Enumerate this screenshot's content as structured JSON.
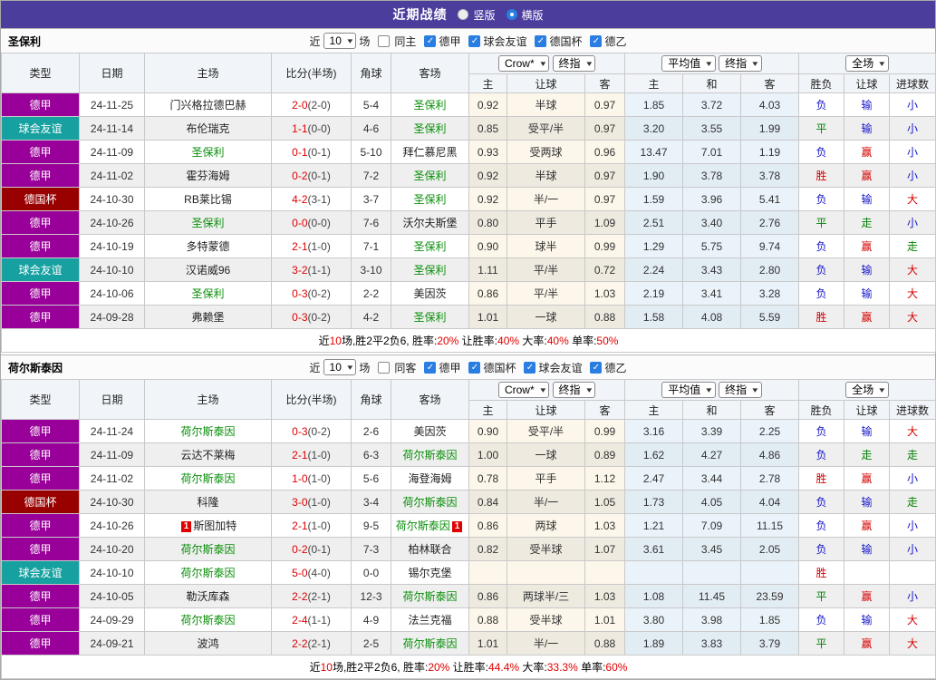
{
  "colors": {
    "accent": "#4b3d9c",
    "league_purple": "#990099",
    "league_teal": "#16a0a0",
    "league_darkred": "#990000",
    "team_green": "#0a8f0a",
    "score_red": "#e00000",
    "win_red": "#d40000",
    "draw_green": "#008000",
    "loss_blue": "#1515c8",
    "checkbox_blue": "#2a7de1"
  },
  "title": {
    "text": "近期战绩",
    "radio_vertical": "竖版",
    "radio_horizontal": "横版",
    "selected": "横版"
  },
  "table_header": {
    "cols": [
      "类型",
      "日期",
      "主场",
      "比分(半场)",
      "角球",
      "客场"
    ],
    "crow_select": "Crow*",
    "final_select": "终指",
    "avg_select": "平均值",
    "final_select2": "终指",
    "full_select": "全场",
    "sub_cols": [
      "主",
      "让球",
      "客",
      "主",
      "和",
      "客",
      "胜负",
      "让球",
      "进球数"
    ]
  },
  "sections": [
    {
      "team": "圣保利",
      "filter": {
        "near": "近",
        "count": "10",
        "games": "场",
        "same": "同主",
        "leagues": [
          "德甲",
          "球会友谊",
          "德国杯",
          "德乙"
        ]
      },
      "rows": [
        {
          "lg": "德甲",
          "lgc": "purple",
          "date": "24-11-25",
          "home": "门兴格拉德巴赫",
          "hh": false,
          "hcard": "",
          "score": "2-0",
          "half": "(2-0)",
          "corner": "5-4",
          "away": "圣保利",
          "ah": true,
          "acard": "",
          "odds": [
            "0.92",
            "半球",
            "0.97"
          ],
          "avg": [
            "1.85",
            "3.72",
            "4.03"
          ],
          "res": [
            [
              "负",
              "b"
            ],
            [
              "输",
              "b"
            ],
            [
              "小",
              "b"
            ]
          ]
        },
        {
          "lg": "球会友谊",
          "lgc": "teal",
          "date": "24-11-14",
          "home": "布伦瑞克",
          "hh": false,
          "hcard": "",
          "score": "1-1",
          "half": "(0-0)",
          "corner": "4-6",
          "away": "圣保利",
          "ah": true,
          "acard": "",
          "odds": [
            "0.85",
            "受平/半",
            "0.97"
          ],
          "avg": [
            "3.20",
            "3.55",
            "1.99"
          ],
          "res": [
            [
              "平",
              "g"
            ],
            [
              "输",
              "b"
            ],
            [
              "小",
              "b"
            ]
          ]
        },
        {
          "lg": "德甲",
          "lgc": "purple",
          "date": "24-11-09",
          "home": "圣保利",
          "hh": true,
          "hcard": "",
          "score": "0-1",
          "half": "(0-1)",
          "corner": "5-10",
          "away": "拜仁慕尼黑",
          "ah": false,
          "acard": "",
          "odds": [
            "0.93",
            "受两球",
            "0.96"
          ],
          "avg": [
            "13.47",
            "7.01",
            "1.19"
          ],
          "res": [
            [
              "负",
              "b"
            ],
            [
              "赢",
              "r"
            ],
            [
              "小",
              "b"
            ]
          ]
        },
        {
          "lg": "德甲",
          "lgc": "purple",
          "date": "24-11-02",
          "home": "霍芬海姆",
          "hh": false,
          "hcard": "",
          "score": "0-2",
          "half": "(0-1)",
          "corner": "7-2",
          "away": "圣保利",
          "ah": true,
          "acard": "",
          "odds": [
            "0.92",
            "半球",
            "0.97"
          ],
          "avg": [
            "1.90",
            "3.78",
            "3.78"
          ],
          "res": [
            [
              "胜",
              "r"
            ],
            [
              "赢",
              "r"
            ],
            [
              "小",
              "b"
            ]
          ]
        },
        {
          "lg": "德国杯",
          "lgc": "darkred",
          "date": "24-10-30",
          "home": "RB莱比锡",
          "hh": false,
          "hcard": "",
          "score": "4-2",
          "half": "(3-1)",
          "corner": "3-7",
          "away": "圣保利",
          "ah": true,
          "acard": "",
          "odds": [
            "0.92",
            "半/一",
            "0.97"
          ],
          "avg": [
            "1.59",
            "3.96",
            "5.41"
          ],
          "res": [
            [
              "负",
              "b"
            ],
            [
              "输",
              "b"
            ],
            [
              "大",
              "r"
            ]
          ]
        },
        {
          "lg": "德甲",
          "lgc": "purple",
          "date": "24-10-26",
          "home": "圣保利",
          "hh": true,
          "hcard": "",
          "score": "0-0",
          "half": "(0-0)",
          "corner": "7-6",
          "away": "沃尔夫斯堡",
          "ah": false,
          "acard": "",
          "odds": [
            "0.80",
            "平手",
            "1.09"
          ],
          "avg": [
            "2.51",
            "3.40",
            "2.76"
          ],
          "res": [
            [
              "平",
              "g"
            ],
            [
              "走",
              "g"
            ],
            [
              "小",
              "b"
            ]
          ]
        },
        {
          "lg": "德甲",
          "lgc": "purple",
          "date": "24-10-19",
          "home": "多特蒙德",
          "hh": false,
          "hcard": "",
          "score": "2-1",
          "half": "(1-0)",
          "corner": "7-1",
          "away": "圣保利",
          "ah": true,
          "acard": "",
          "odds": [
            "0.90",
            "球半",
            "0.99"
          ],
          "avg": [
            "1.29",
            "5.75",
            "9.74"
          ],
          "res": [
            [
              "负",
              "b"
            ],
            [
              "赢",
              "r"
            ],
            [
              "走",
              "g"
            ]
          ]
        },
        {
          "lg": "球会友谊",
          "lgc": "teal",
          "date": "24-10-10",
          "home": "汉诺威96",
          "hh": false,
          "hcard": "",
          "score": "3-2",
          "half": "(1-1)",
          "corner": "3-10",
          "away": "圣保利",
          "ah": true,
          "acard": "",
          "odds": [
            "1.11",
            "平/半",
            "0.72"
          ],
          "avg": [
            "2.24",
            "3.43",
            "2.80"
          ],
          "res": [
            [
              "负",
              "b"
            ],
            [
              "输",
              "b"
            ],
            [
              "大",
              "r"
            ]
          ]
        },
        {
          "lg": "德甲",
          "lgc": "purple",
          "date": "24-10-06",
          "home": "圣保利",
          "hh": true,
          "hcard": "",
          "score": "0-3",
          "half": "(0-2)",
          "corner": "2-2",
          "away": "美因茨",
          "ah": false,
          "acard": "",
          "odds": [
            "0.86",
            "平/半",
            "1.03"
          ],
          "avg": [
            "2.19",
            "3.41",
            "3.28"
          ],
          "res": [
            [
              "负",
              "b"
            ],
            [
              "输",
              "b"
            ],
            [
              "大",
              "r"
            ]
          ]
        },
        {
          "lg": "德甲",
          "lgc": "purple",
          "date": "24-09-28",
          "home": "弗赖堡",
          "hh": false,
          "hcard": "",
          "score": "0-3",
          "half": "(0-2)",
          "corner": "4-2",
          "away": "圣保利",
          "ah": true,
          "acard": "",
          "odds": [
            "1.01",
            "一球",
            "0.88"
          ],
          "avg": [
            "1.58",
            "4.08",
            "5.59"
          ],
          "res": [
            [
              "胜",
              "r"
            ],
            [
              "赢",
              "r"
            ],
            [
              "大",
              "r"
            ]
          ]
        }
      ],
      "summary": {
        "p1": "近",
        "n1": "10",
        "p2": "场,胜2平2负6, 胜率:",
        "v1": "20%",
        "p3": " 让胜率:",
        "v2": "40%",
        "p4": " 大率:",
        "v3": "40%",
        "p5": " 单率:",
        "v4": "50%"
      }
    },
    {
      "team": "荷尔斯泰因",
      "filter": {
        "near": "近",
        "count": "10",
        "games": "场",
        "same": "同客",
        "leagues": [
          "德甲",
          "德国杯",
          "球会友谊",
          "德乙"
        ]
      },
      "rows": [
        {
          "lg": "德甲",
          "lgc": "purple",
          "date": "24-11-24",
          "home": "荷尔斯泰因",
          "hh": true,
          "hcard": "",
          "score": "0-3",
          "half": "(0-2)",
          "corner": "2-6",
          "away": "美因茨",
          "ah": false,
          "acard": "",
          "odds": [
            "0.90",
            "受平/半",
            "0.99"
          ],
          "avg": [
            "3.16",
            "3.39",
            "2.25"
          ],
          "res": [
            [
              "负",
              "b"
            ],
            [
              "输",
              "b"
            ],
            [
              "大",
              "r"
            ]
          ]
        },
        {
          "lg": "德甲",
          "lgc": "purple",
          "date": "24-11-09",
          "home": "云达不莱梅",
          "hh": false,
          "hcard": "",
          "score": "2-1",
          "half": "(1-0)",
          "corner": "6-3",
          "away": "荷尔斯泰因",
          "ah": true,
          "acard": "",
          "odds": [
            "1.00",
            "一球",
            "0.89"
          ],
          "avg": [
            "1.62",
            "4.27",
            "4.86"
          ],
          "res": [
            [
              "负",
              "b"
            ],
            [
              "走",
              "g"
            ],
            [
              "走",
              "g"
            ]
          ]
        },
        {
          "lg": "德甲",
          "lgc": "purple",
          "date": "24-11-02",
          "home": "荷尔斯泰因",
          "hh": true,
          "hcard": "",
          "score": "1-0",
          "half": "(1-0)",
          "corner": "5-6",
          "away": "海登海姆",
          "ah": false,
          "acard": "",
          "odds": [
            "0.78",
            "平手",
            "1.12"
          ],
          "avg": [
            "2.47",
            "3.44",
            "2.78"
          ],
          "res": [
            [
              "胜",
              "r"
            ],
            [
              "赢",
              "r"
            ],
            [
              "小",
              "b"
            ]
          ]
        },
        {
          "lg": "德国杯",
          "lgc": "darkred",
          "date": "24-10-30",
          "home": "科隆",
          "hh": false,
          "hcard": "",
          "score": "3-0",
          "half": "(1-0)",
          "corner": "3-4",
          "away": "荷尔斯泰因",
          "ah": true,
          "acard": "",
          "odds": [
            "0.84",
            "半/一",
            "1.05"
          ],
          "avg": [
            "1.73",
            "4.05",
            "4.04"
          ],
          "res": [
            [
              "负",
              "b"
            ],
            [
              "输",
              "b"
            ],
            [
              "走",
              "g"
            ]
          ]
        },
        {
          "lg": "德甲",
          "lgc": "purple",
          "date": "24-10-26",
          "home": "斯图加特",
          "hh": false,
          "hcard": "1",
          "score": "2-1",
          "half": "(1-0)",
          "corner": "9-5",
          "away": "荷尔斯泰因",
          "ah": true,
          "acard": "1",
          "odds": [
            "0.86",
            "两球",
            "1.03"
          ],
          "avg": [
            "1.21",
            "7.09",
            "11.15"
          ],
          "res": [
            [
              "负",
              "b"
            ],
            [
              "赢",
              "r"
            ],
            [
              "小",
              "b"
            ]
          ]
        },
        {
          "lg": "德甲",
          "lgc": "purple",
          "date": "24-10-20",
          "home": "荷尔斯泰因",
          "hh": true,
          "hcard": "",
          "score": "0-2",
          "half": "(0-1)",
          "corner": "7-3",
          "away": "柏林联合",
          "ah": false,
          "acard": "",
          "odds": [
            "0.82",
            "受半球",
            "1.07"
          ],
          "avg": [
            "3.61",
            "3.45",
            "2.05"
          ],
          "res": [
            [
              "负",
              "b"
            ],
            [
              "输",
              "b"
            ],
            [
              "小",
              "b"
            ]
          ]
        },
        {
          "lg": "球会友谊",
          "lgc": "teal",
          "date": "24-10-10",
          "home": "荷尔斯泰因",
          "hh": true,
          "hcard": "",
          "score": "5-0",
          "half": "(4-0)",
          "corner": "0-0",
          "away": "锡尔克堡",
          "ah": false,
          "acard": "",
          "odds": [
            "",
            "",
            ""
          ],
          "avg": [
            "",
            "",
            ""
          ],
          "res": [
            [
              "胜",
              "r"
            ],
            [
              "",
              ""
            ],
            [
              "",
              ""
            ]
          ]
        },
        {
          "lg": "德甲",
          "lgc": "purple",
          "date": "24-10-05",
          "home": "勒沃库森",
          "hh": false,
          "hcard": "",
          "score": "2-2",
          "half": "(2-1)",
          "corner": "12-3",
          "away": "荷尔斯泰因",
          "ah": true,
          "acard": "",
          "odds": [
            "0.86",
            "两球半/三",
            "1.03"
          ],
          "avg": [
            "1.08",
            "11.45",
            "23.59"
          ],
          "res": [
            [
              "平",
              "g"
            ],
            [
              "赢",
              "r"
            ],
            [
              "小",
              "b"
            ]
          ]
        },
        {
          "lg": "德甲",
          "lgc": "purple",
          "date": "24-09-29",
          "home": "荷尔斯泰因",
          "hh": true,
          "hcard": "",
          "score": "2-4",
          "half": "(1-1)",
          "corner": "4-9",
          "away": "法兰克福",
          "ah": false,
          "acard": "",
          "odds": [
            "0.88",
            "受半球",
            "1.01"
          ],
          "avg": [
            "3.80",
            "3.98",
            "1.85"
          ],
          "res": [
            [
              "负",
              "b"
            ],
            [
              "输",
              "b"
            ],
            [
              "大",
              "r"
            ]
          ]
        },
        {
          "lg": "德甲",
          "lgc": "purple",
          "date": "24-09-21",
          "home": "波鸿",
          "hh": false,
          "hcard": "",
          "score": "2-2",
          "half": "(2-1)",
          "corner": "2-5",
          "away": "荷尔斯泰因",
          "ah": true,
          "acard": "",
          "odds": [
            "1.01",
            "半/一",
            "0.88"
          ],
          "avg": [
            "1.89",
            "3.83",
            "3.79"
          ],
          "res": [
            [
              "平",
              "g"
            ],
            [
              "赢",
              "r"
            ],
            [
              "大",
              "r"
            ]
          ]
        }
      ],
      "summary": {
        "p1": "近",
        "n1": "10",
        "p2": "场,胜2平2负6, 胜率:",
        "v1": "20%",
        "p3": " 让胜率:",
        "v2": "44.4%",
        "p4": " 大率:",
        "v3": "33.3%",
        "p5": " 单率:",
        "v4": "60%"
      }
    }
  ]
}
